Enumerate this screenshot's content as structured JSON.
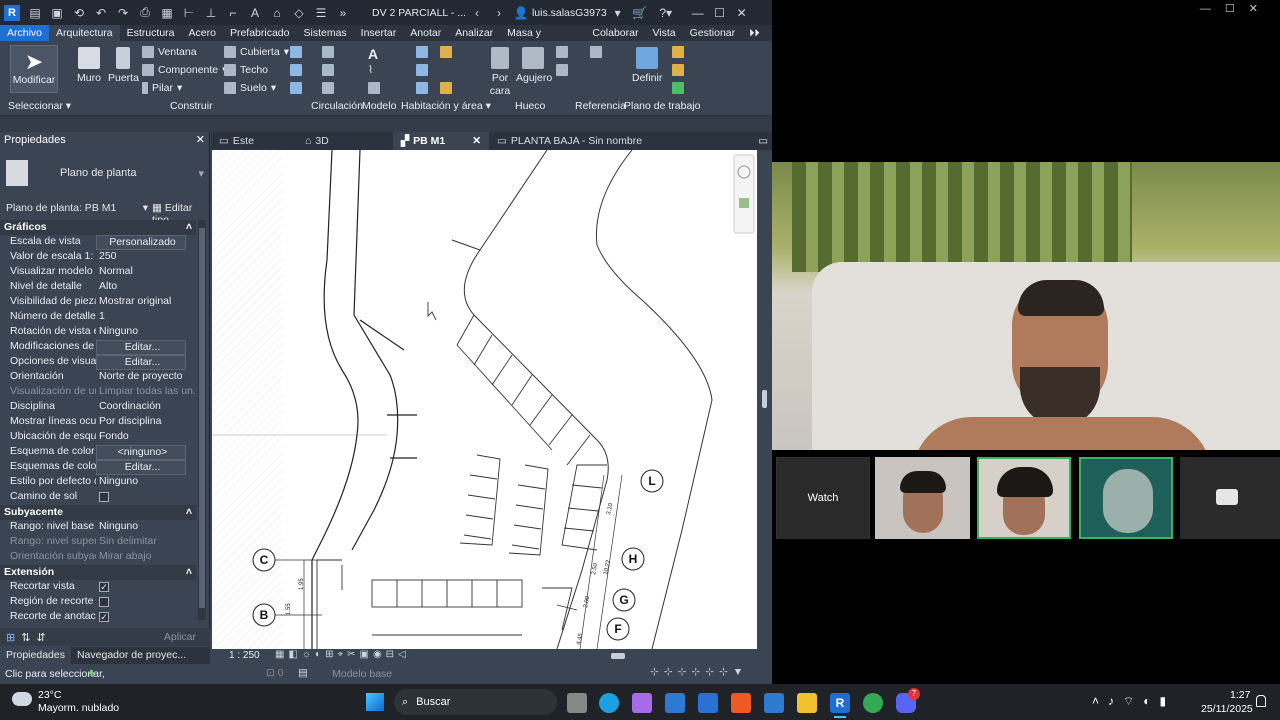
{
  "titlebar": {
    "app_logo": "R",
    "doc_title": "DV 2 PARCIALL - ...",
    "user": "luis.salasG3973",
    "icons": [
      "open-icon",
      "save-icon",
      "undo-icon",
      "redo-icon",
      "print-icon",
      "measure-icon",
      "text-icon",
      "home-icon",
      "switch-windows-icon",
      "cart-icon",
      "help-icon"
    ]
  },
  "ribbon_tabs": [
    "Archivo",
    "Arquitectura",
    "Estructura",
    "Acero",
    "Prefabricado",
    "Sistemas",
    "Insertar",
    "Anotar",
    "Analizar",
    "Masa y emplazamiento",
    "Colaborar",
    "Vista",
    "Gestionar"
  ],
  "ribbon": {
    "modify": "Modificar",
    "wall": "Muro",
    "door": "Puerta",
    "window": "Ventana",
    "component": "Componente",
    "column": "Pilar",
    "roof": "Cubierta",
    "ceiling": "Techo",
    "floor": "Suelo",
    "by_face": "Por cara",
    "shaft": "Agujero",
    "set": "Definir",
    "groups": {
      "select": "Seleccionar",
      "build": "Construir",
      "circulation": "Circulación",
      "model": "Modelo",
      "room_area": "Habitación y área",
      "opening": "Hueco",
      "datum": "Referencia",
      "workplane": "Plano de trabajo"
    }
  },
  "properties": {
    "header": "Propiedades",
    "type_name": "Plano de planta",
    "selector": "Plano de planta: PB M1",
    "edit_type": "Editar tipo",
    "sections": {
      "graphics": "Gráficos",
      "underlay": "Subyacente",
      "extents": "Extensión"
    },
    "rows": [
      {
        "k": "Escala de vista",
        "v": "Personalizado"
      },
      {
        "k": "Valor de escala    1:",
        "v": "250"
      },
      {
        "k": "Visualizar modelo",
        "v": "Normal"
      },
      {
        "k": "Nivel de detalle",
        "v": "Alto"
      },
      {
        "k": "Visibilidad de piezas",
        "v": "Mostrar original"
      },
      {
        "k": "Número de detalle",
        "v": "1"
      },
      {
        "k": "Rotación de vista en...",
        "v": "Ninguno"
      },
      {
        "k": "Modificaciones de vi...",
        "v": "Editar..."
      },
      {
        "k": "Opciones de visualiz...",
        "v": "Editar..."
      },
      {
        "k": "Orientación",
        "v": "Norte de proyecto"
      },
      {
        "k": "Visualización de uni...",
        "v": "Limpiar todas las un..."
      },
      {
        "k": "Disciplina",
        "v": "Coordinación"
      },
      {
        "k": "Mostrar líneas ocultas",
        "v": "Por disciplina"
      },
      {
        "k": "Ubicación de esque...",
        "v": "Fondo"
      },
      {
        "k": "Esquema de color",
        "v": "<ninguno>"
      },
      {
        "k": "Esquemas de color ...",
        "v": "Editar..."
      },
      {
        "k": "Estilo por defecto d...",
        "v": "Ninguno"
      },
      {
        "k": "Camino de sol",
        "v": ""
      }
    ],
    "underlay_rows": [
      {
        "k": "Rango: nivel base",
        "v": "Ninguno"
      },
      {
        "k": "Rango: nivel superior",
        "v": "Sin delimitar"
      },
      {
        "k": "Orientación subyace...",
        "v": "Mirar abajo"
      }
    ],
    "extent_rows": [
      {
        "k": "Recortar vista",
        "v": "✓"
      },
      {
        "k": "Región de recorte vi...",
        "v": ""
      },
      {
        "k": "Recorte de anotación",
        "v": "✓"
      }
    ],
    "apply": "Aplicar",
    "foot_tabs": [
      "Propiedades",
      "Navegador de proyec..."
    ]
  },
  "view_tabs": [
    {
      "label": "Este",
      "active": false
    },
    {
      "label": "3D",
      "active": false
    },
    {
      "label": "PB M1",
      "active": true
    },
    {
      "label": "PLANTA BAJA - Sin nombre",
      "active": false
    }
  ],
  "grid_labels": [
    "L",
    "H",
    "G",
    "F",
    "C",
    "B"
  ],
  "dims": [
    "3.10",
    "2.50",
    "10.50",
    "10.22",
    "2.00",
    "4.45",
    "1.55",
    "1.95"
  ],
  "view_scale": "1 : 250",
  "status": {
    "hint": "Clic para seleccionar,",
    "model_base": "Modelo base"
  },
  "video": {
    "watch": "Watch"
  },
  "taskbar": {
    "weather_temp": "23°C",
    "weather_desc": "Mayorm. nublado",
    "search": "Buscar",
    "time": "1:27",
    "date": "25/11/2025",
    "discord_badge": "7"
  }
}
